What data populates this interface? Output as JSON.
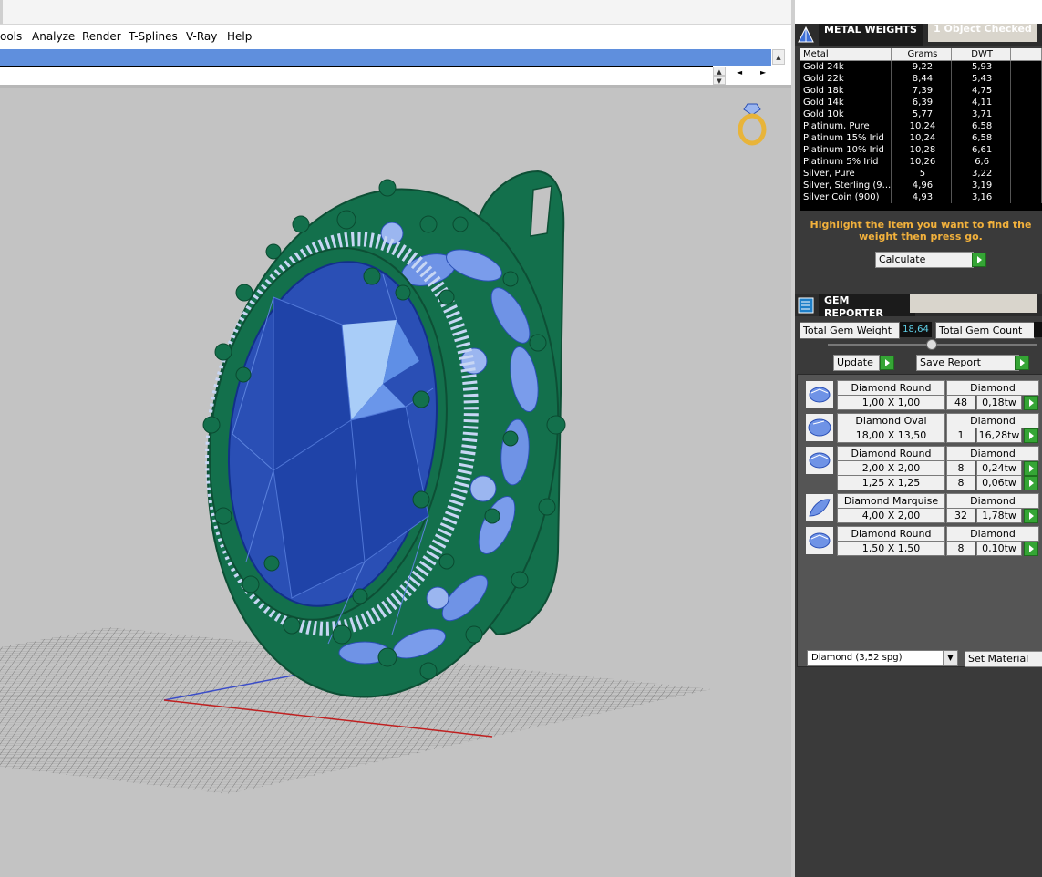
{
  "menu": {
    "items": [
      "ools",
      "Analyze",
      "Render",
      "T-Splines",
      "V-Ray",
      "Help"
    ]
  },
  "metal_weights": {
    "title": "METAL WEIGHTS",
    "status": "1 Object Checked",
    "columns": [
      "Metal",
      "Grams",
      "DWT"
    ],
    "rows": [
      [
        "Gold 24k",
        "9,22",
        "5,93"
      ],
      [
        "Gold 22k",
        "8,44",
        "5,43"
      ],
      [
        "Gold 18k",
        "7,39",
        "4,75"
      ],
      [
        "Gold 14k",
        "6,39",
        "4,11"
      ],
      [
        "Gold 10k",
        "5,77",
        "3,71"
      ],
      [
        "Platinum, Pure",
        "10,24",
        "6,58"
      ],
      [
        "Platinum 15% Irid",
        "10,24",
        "6,58"
      ],
      [
        "Platinum 10% Irid",
        "10,28",
        "6,61"
      ],
      [
        "Platinum 5% Irid",
        "10,26",
        "6,6"
      ],
      [
        "Silver, Pure",
        "5",
        "3,22"
      ],
      [
        "Silver, Sterling (9...",
        "4,96",
        "3,19"
      ],
      [
        "Silver Coin (900)",
        "4,93",
        "3,16"
      ]
    ],
    "hint": "Highlight the item you want to find the weight then press go.",
    "calculate_label": "Calculate"
  },
  "gem_reporter": {
    "title": "GEM REPORTER",
    "total_weight_label": "Total Gem Weight",
    "total_weight_value": "18,64",
    "total_count_label": "Total Gem Count",
    "update_label": "Update",
    "save_report_label": "Save Report",
    "groups": [
      {
        "name": "Diamond Round",
        "material": "Diamond",
        "icon": "round-gem-icon",
        "rows": [
          {
            "size": "1,00 X 1,00",
            "count": "48",
            "weight": "0,18tw"
          }
        ]
      },
      {
        "name": "Diamond Oval",
        "material": "Diamond",
        "icon": "oval-gem-icon",
        "rows": [
          {
            "size": "18,00 X 13,50",
            "count": "1",
            "weight": "16,28tw"
          }
        ]
      },
      {
        "name": "Diamond Round",
        "material": "Diamond",
        "icon": "round-gem-icon",
        "rows": [
          {
            "size": "2,00 X 2,00",
            "count": "8",
            "weight": "0,24tw"
          },
          {
            "size": "1,25 X 1,25",
            "count": "8",
            "weight": "0,06tw"
          }
        ]
      },
      {
        "name": "Diamond Marquise",
        "material": "Diamond",
        "icon": "marquise-gem-icon",
        "rows": [
          {
            "size": "4,00 X 2,00",
            "count": "32",
            "weight": "1,78tw"
          }
        ]
      },
      {
        "name": "Diamond Round",
        "material": "Diamond",
        "icon": "round-gem-icon",
        "rows": [
          {
            "size": "1,50 X 1,50",
            "count": "8",
            "weight": "0,10tw"
          }
        ]
      }
    ],
    "material_select": "Diamond      (3,52 spg)",
    "set_material_label": "Set Material"
  },
  "colors": {
    "viewport_bg": "#c3c3c3",
    "command_blue": "#5f8fdd",
    "panel_bg": "#3a3a3a",
    "hint_orange": "#f2b13c",
    "go_green": "#35a535",
    "metal_green": "#13704c",
    "gem_blue": "#2a4fb5"
  }
}
